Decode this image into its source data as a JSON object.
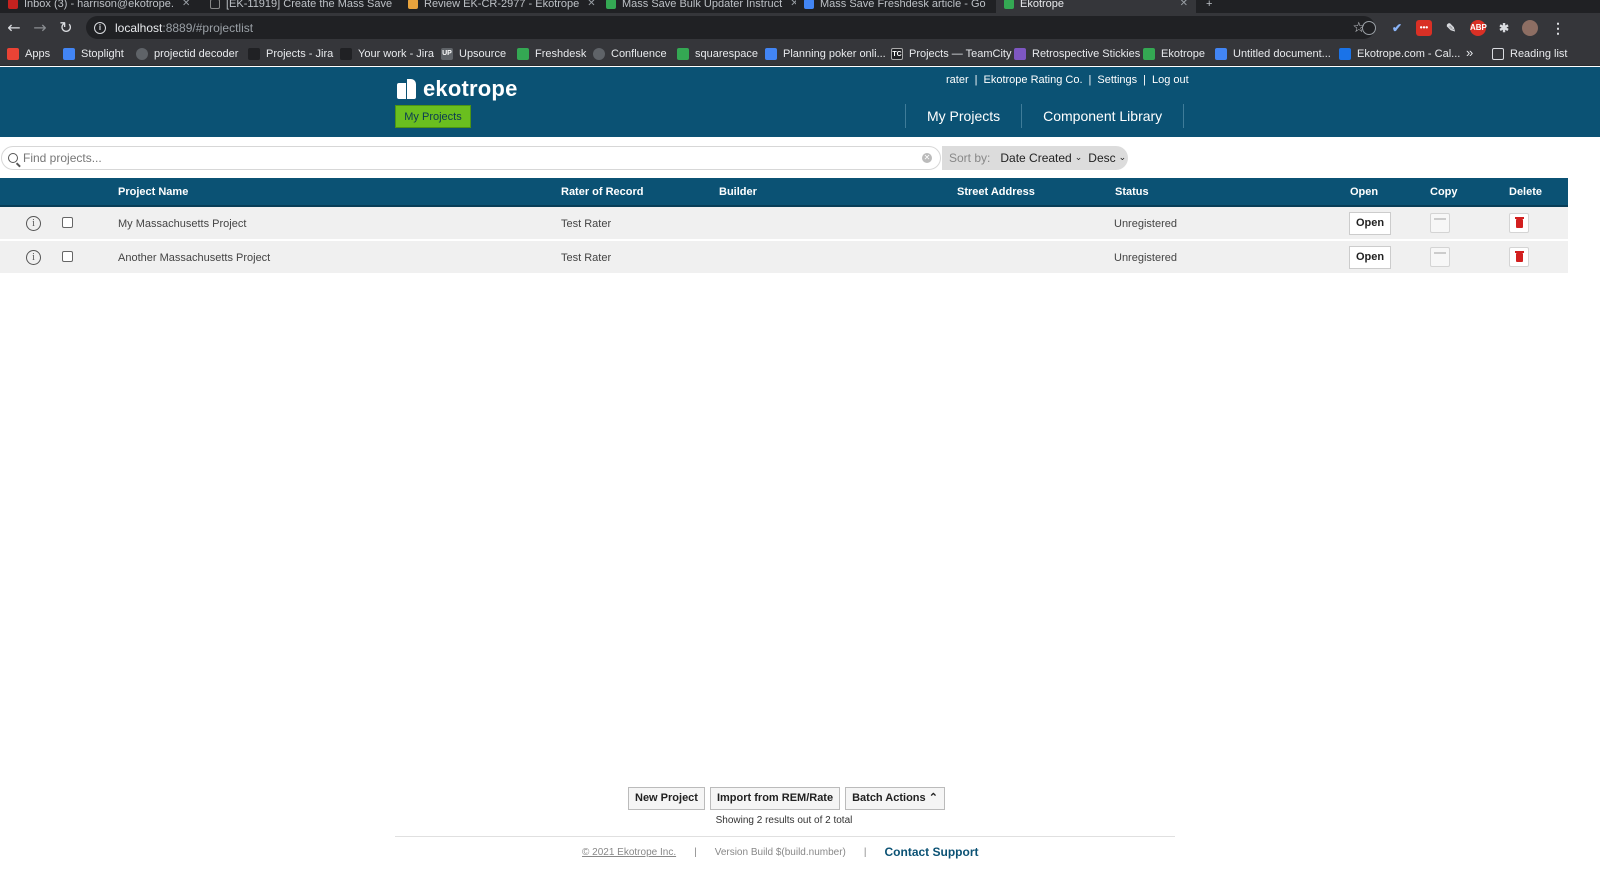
{
  "browser": {
    "tabs": [
      {
        "title": "Inbox (3) - harrison@ekotrope.",
        "fav_color": "#c5221f"
      },
      {
        "title": "[EK-11919] Create the Mass Save",
        "fav_color": "#202124"
      },
      {
        "title": "Review EK-CR-2977 - Ekotrope",
        "fav_color": "#e8a33d"
      },
      {
        "title": "Mass Save Bulk Updater Instruct",
        "fav_color": "#34a853"
      },
      {
        "title": "Mass Save Freshdesk article - Go",
        "fav_color": "#4285f4"
      },
      {
        "title": "Ekotrope",
        "fav_color": "#34a853"
      }
    ],
    "url_host": "localhost",
    "url_rest": ":8889/#projectlist",
    "bookmarks": [
      {
        "label": "Apps",
        "color": "#ea4335"
      },
      {
        "label": "Stoplight",
        "color": "#4285f4"
      },
      {
        "label": "projectid decoder",
        "color": "#5f6368"
      },
      {
        "label": "Projects - Jira",
        "color": "#202124"
      },
      {
        "label": "Your work - Jira",
        "color": "#202124"
      },
      {
        "label": "Upsource",
        "color": "#5f6368"
      },
      {
        "label": "Freshdesk",
        "color": "#34a853"
      },
      {
        "label": "Confluence",
        "color": "#5f6368"
      },
      {
        "label": "squarespace",
        "color": "#34a853"
      },
      {
        "label": "Planning poker onli...",
        "color": "#4285f4"
      },
      {
        "label": "Projects — TeamCity",
        "color": "#202124"
      },
      {
        "label": "Retrospective Stickies",
        "color": "#7e57c2"
      },
      {
        "label": "Ekotrope",
        "color": "#34a853"
      },
      {
        "label": "Untitled document...",
        "color": "#4285f4"
      },
      {
        "label": "Ekotrope.com - Cal...",
        "color": "#1a73e8"
      }
    ],
    "bookmarks_more": "»",
    "reading_list": "Reading list"
  },
  "header": {
    "logo_text": "ekotrope",
    "my_projects_button": "My Projects",
    "user": "rater",
    "company": "Ekotrope Rating Co.",
    "settings": "Settings",
    "logout": "Log out",
    "nav": [
      "My Projects",
      "Component Library"
    ]
  },
  "search": {
    "placeholder": "Find projects...",
    "sort_label": "Sort by:",
    "sort_field": "Date Created",
    "sort_order": "Desc"
  },
  "table": {
    "columns": {
      "name": "Project Name",
      "rater": "Rater of Record",
      "builder": "Builder",
      "address": "Street Address",
      "status": "Status",
      "open": "Open",
      "copy": "Copy",
      "delete": "Delete"
    },
    "rows": [
      {
        "name": "My Massachusetts Project",
        "rater": "Test Rater",
        "builder": "",
        "address": "",
        "status": "Unregistered",
        "open_label": "Open"
      },
      {
        "name": "Another Massachusetts Project",
        "rater": "Test Rater",
        "builder": "",
        "address": "",
        "status": "Unregistered",
        "open_label": "Open"
      }
    ]
  },
  "footer": {
    "new_project": "New Project",
    "import": "Import from REM/Rate",
    "batch_actions": "Batch Actions ⌃",
    "results": "Showing 2 results out of 2 total",
    "copyright": "© 2021 Ekotrope Inc.",
    "separator": "|",
    "version": "Version Build $(build.number)",
    "support": "Contact Support"
  },
  "colors": {
    "brand": "#0b5274",
    "accent_green": "#6abf1f",
    "row_bg": "#f0f0f0"
  }
}
